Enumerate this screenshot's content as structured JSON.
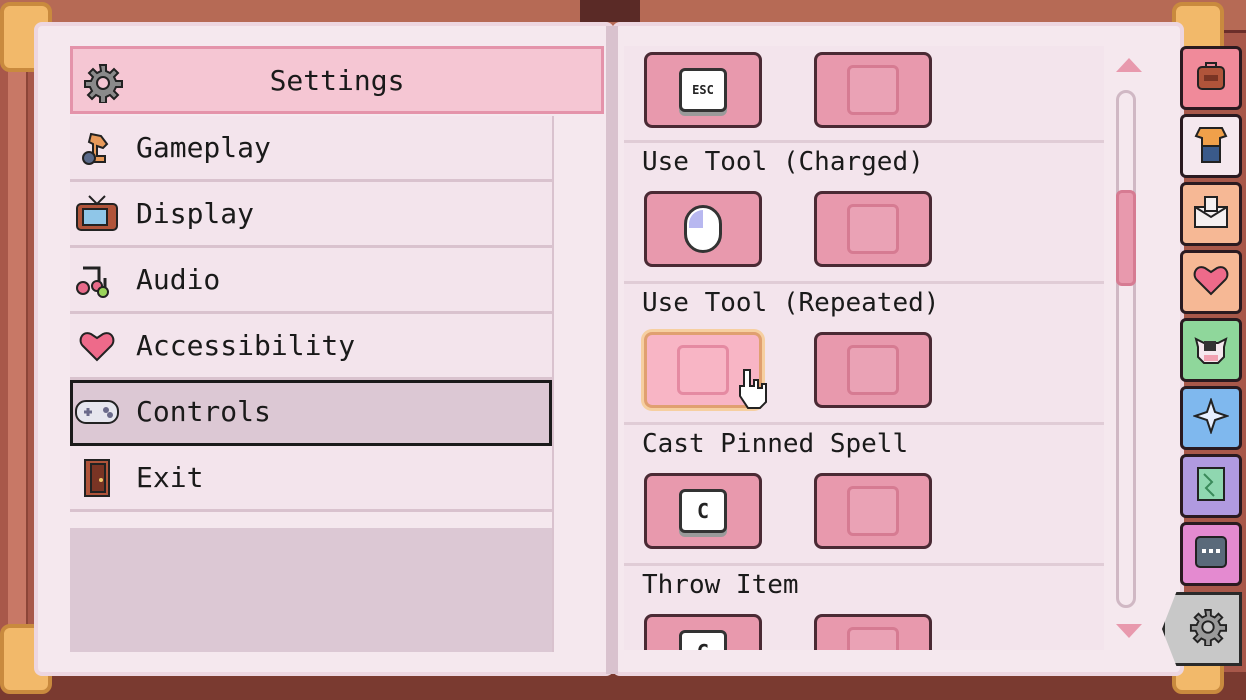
{
  "menu": {
    "header_title": "Settings",
    "items": [
      {
        "label": "Gameplay"
      },
      {
        "label": "Display"
      },
      {
        "label": "Audio"
      },
      {
        "label": "Accessibility"
      },
      {
        "label": "Controls",
        "selected": true
      },
      {
        "label": "Exit"
      }
    ]
  },
  "controls": {
    "sections": [
      {
        "title": "",
        "primary": "ESC",
        "secondary": ""
      },
      {
        "title": "Use Tool (Charged)",
        "primary": "mouse-left",
        "secondary": ""
      },
      {
        "title": "Use Tool (Repeated)",
        "primary": "",
        "secondary": ""
      },
      {
        "title": "Cast Pinned Spell",
        "primary": "C",
        "secondary": ""
      },
      {
        "title": "Throw Item",
        "primary": "G",
        "secondary": ""
      }
    ]
  },
  "tabs": [
    {
      "name": "backpack-icon",
      "color": "#f08a9a"
    },
    {
      "name": "clothes-icon",
      "color": "#f5e8ee"
    },
    {
      "name": "mail-icon",
      "color": "#f6b895"
    },
    {
      "name": "heart-icon",
      "color": "#f6b895"
    },
    {
      "name": "cow-icon",
      "color": "#8fd79b"
    },
    {
      "name": "sparkle-icon",
      "color": "#7fb8ee"
    },
    {
      "name": "map-icon",
      "color": "#b09ae0"
    },
    {
      "name": "journal-icon",
      "color": "#e48ad0"
    },
    {
      "name": "settings-gear-icon",
      "color": "#c8c8c8"
    }
  ]
}
